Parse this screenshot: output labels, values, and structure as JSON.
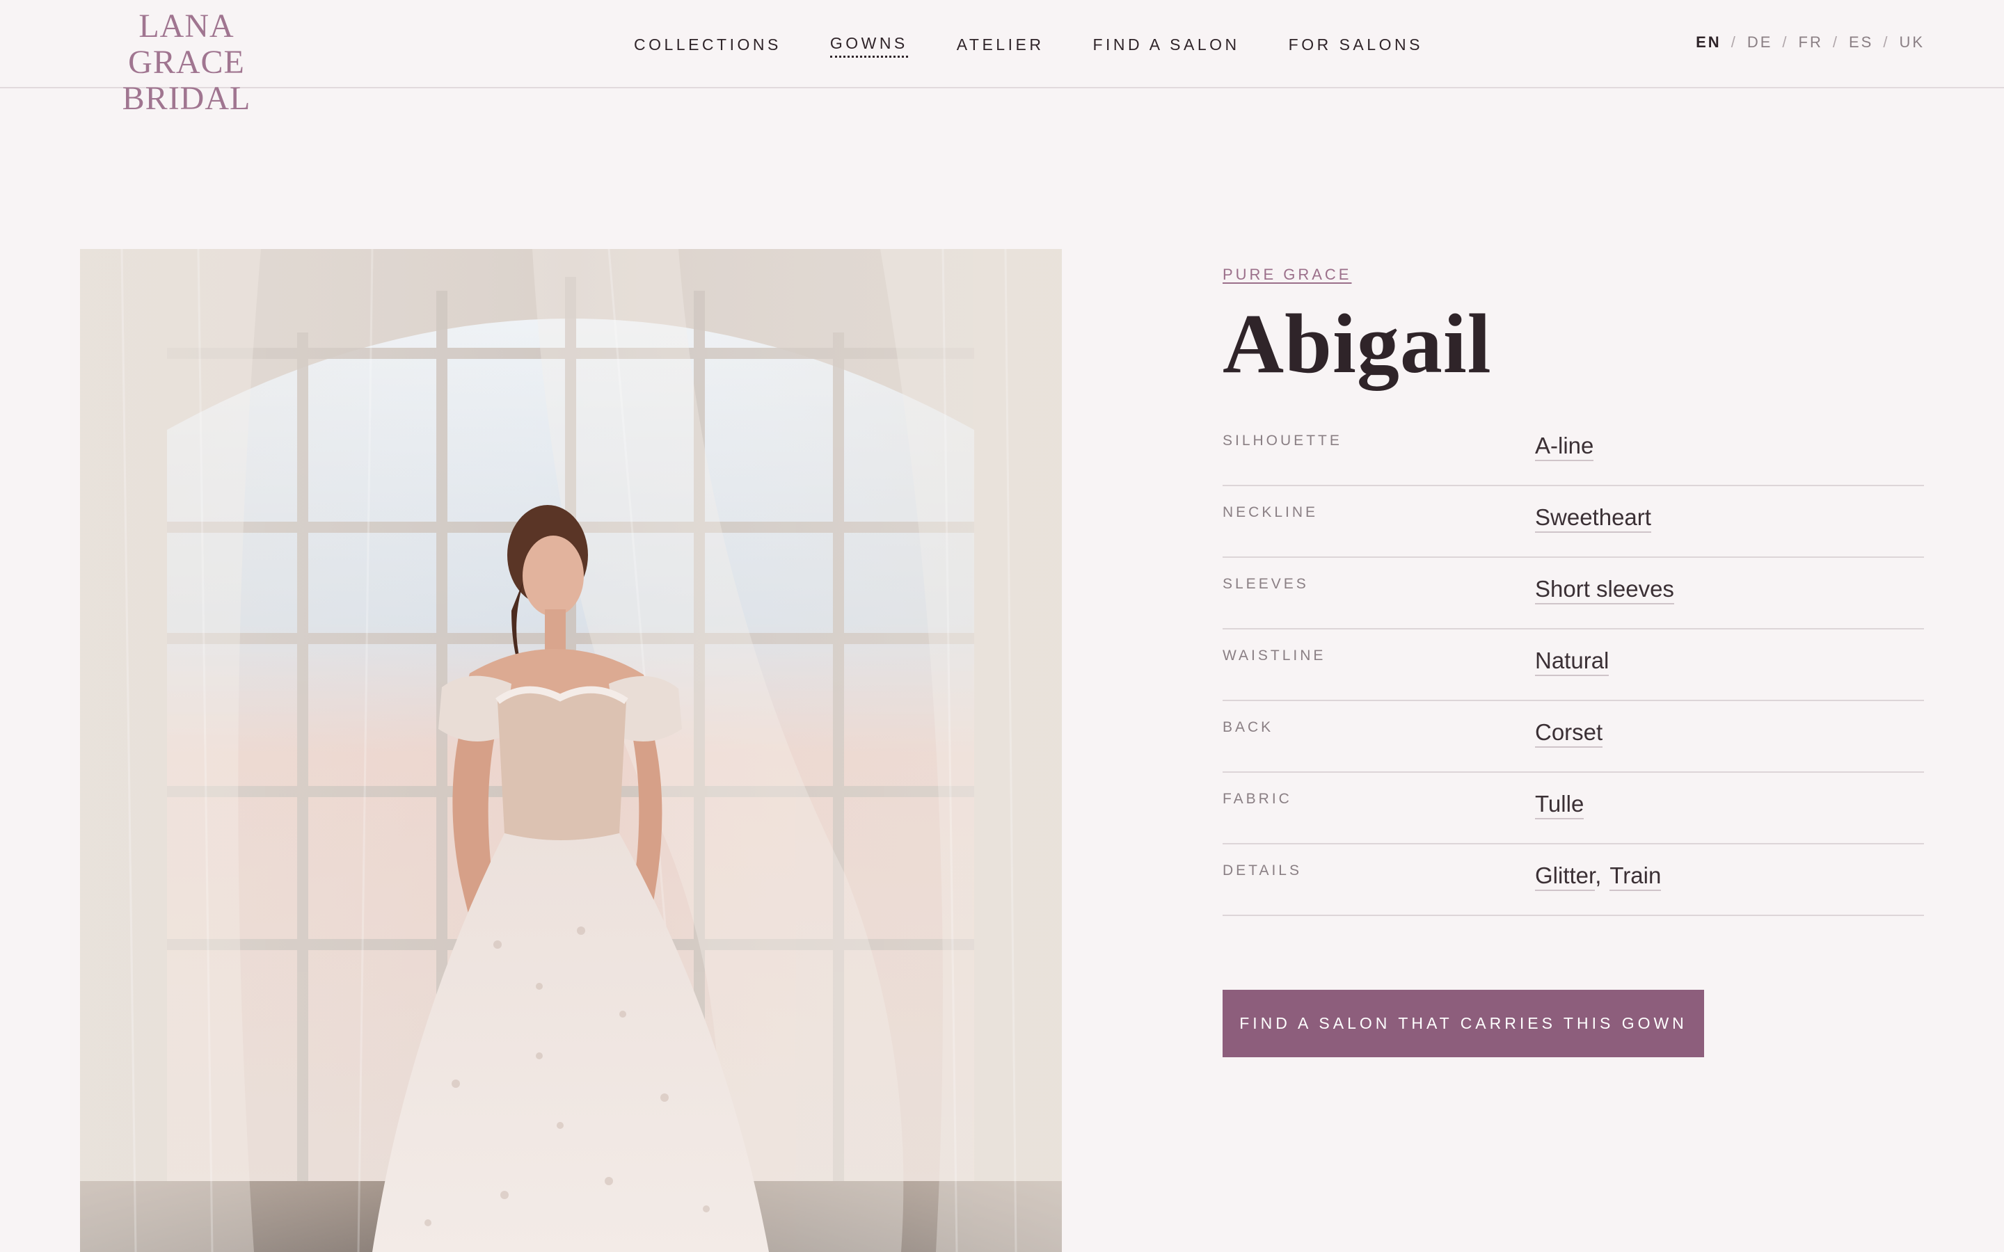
{
  "brand": {
    "logo_line1": "LANA GRACE",
    "logo_line2": "BRIDAL"
  },
  "nav": {
    "items": [
      {
        "label": "COLLECTIONS",
        "active": false
      },
      {
        "label": "GOWNS",
        "active": true
      },
      {
        "label": "ATELIER",
        "active": false
      },
      {
        "label": "FIND A SALON",
        "active": false
      },
      {
        "label": "FOR SALONS",
        "active": false
      }
    ]
  },
  "languages": {
    "items": [
      "EN",
      "DE",
      "FR",
      "ES",
      "UK"
    ],
    "selected": "EN",
    "separator": "/"
  },
  "product": {
    "collection": "PURE GRACE",
    "name": "Abigail",
    "specs": [
      {
        "label": "SILHOUETTE",
        "values": [
          "A-line"
        ]
      },
      {
        "label": "NECKLINE",
        "values": [
          "Sweetheart"
        ]
      },
      {
        "label": "SLEEVES",
        "values": [
          "Short sleeves"
        ]
      },
      {
        "label": "WAISTLINE",
        "values": [
          "Natural"
        ]
      },
      {
        "label": "BACK",
        "values": [
          "Corset"
        ]
      },
      {
        "label": "FABRIC",
        "values": [
          "Tulle"
        ]
      },
      {
        "label": "DETAILS",
        "values": [
          "Glitter",
          "Train"
        ]
      }
    ],
    "cta_label": "FIND A SALON THAT CARRIES THIS GOWN"
  },
  "colors": {
    "accent": "#8d5e7c",
    "logo": "#a07590",
    "background": "#f8f4f5",
    "text": "#2f2429"
  }
}
